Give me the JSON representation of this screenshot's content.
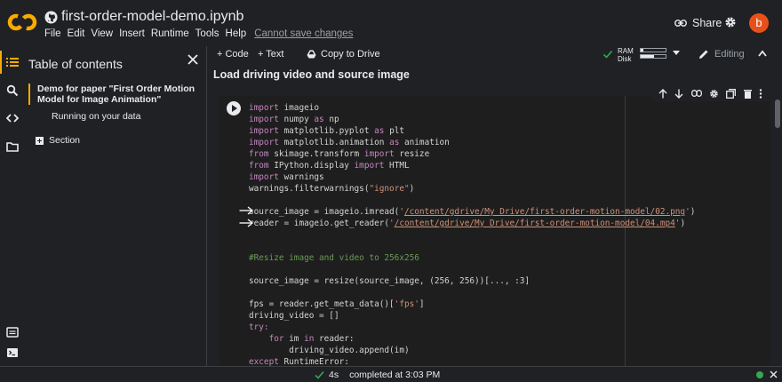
{
  "header": {
    "notebook_title": "first-order-model-demo.ipynb",
    "menu": [
      "File",
      "Edit",
      "View",
      "Insert",
      "Runtime",
      "Tools",
      "Help"
    ],
    "unsaved_label": "Cannot save changes",
    "share_label": "Share",
    "avatar_letter": "b",
    "brand_color": "#f9ab00",
    "avatar_color": "#e8501a"
  },
  "rail": {
    "icons": [
      "toc-icon",
      "search-icon",
      "code-snippets-icon",
      "files-icon",
      "terminal-list-icon",
      "terminal-icon"
    ]
  },
  "toc": {
    "title": "Table of contents",
    "items": [
      {
        "label": "Demo for paper \"First Order Motion Model for Image Animation\""
      },
      {
        "label": "Running on your data"
      },
      {
        "label": "Section"
      }
    ]
  },
  "toolbar": {
    "code_label": "+ Code",
    "text_label": "+ Text",
    "drive_label": "Copy to Drive",
    "ram_label": "RAM",
    "disk_label": "Disk",
    "ram_fraction": 0.1,
    "disk_fraction": 0.55,
    "editing_label": "Editing"
  },
  "notebook": {
    "section_title": "Load driving video and source image",
    "code": {
      "l1_kw": "import",
      "l1_rest": " imageio",
      "l2_kw": "import",
      "l2_rest": " numpy ",
      "l2_kw2": "as",
      "l2_rest2": " np",
      "l3_kw": "import",
      "l3_rest": " matplotlib.pyplot ",
      "l3_kw2": "as",
      "l3_rest2": " plt",
      "l4_kw": "import",
      "l4_rest": " matplotlib.animation ",
      "l4_kw2": "as",
      "l4_rest2": " animation",
      "l5_kw": "from",
      "l5_rest": " skimage.transform ",
      "l5_kw2": "import",
      "l5_rest2": " resize",
      "l6_kw": "from",
      "l6_rest": " IPython.display ",
      "l6_kw2": "import",
      "l6_rest2": " HTML",
      "l7_kw": "import",
      "l7_rest": " warnings",
      "l8_pre": "warnings.filterwarnings(",
      "l8_str": "\"ignore\"",
      "l8_post": ")",
      "l10_pre": "source_image = imageio.imread(",
      "l10_q1": "'",
      "l10_path": "/content/gdrive/My Drive/first-order-motion-model/02.png",
      "l10_q2": "'",
      "l10_post": ")",
      "l11_pre": "reader = imageio.get_reader(",
      "l11_q1": "'",
      "l11_path": "/content/gdrive/My Drive/first-order-motion-model/04.mp4",
      "l11_q2": "'",
      "l11_post": ")",
      "l14_comment": "#Resize image and video to 256x256",
      "l16": "source_image = resize(source_image, (256, 256))[..., :3]",
      "l18_pre": "fps = reader.get_meta_data()[",
      "l18_str": "'fps'",
      "l18_post": "]",
      "l19": "driving_video = []",
      "l20": "try:",
      "l21_indent": "    ",
      "l21_kw": "for",
      "l21_mid": " im ",
      "l21_kw2": "in",
      "l21_rest": " reader:",
      "l22": "        driving_video.append(im)",
      "l23_kw": "except",
      "l23_rest": " RuntimeError:"
    }
  },
  "status": {
    "duration": "4s",
    "completed_label": "completed at 3:03 PM"
  }
}
